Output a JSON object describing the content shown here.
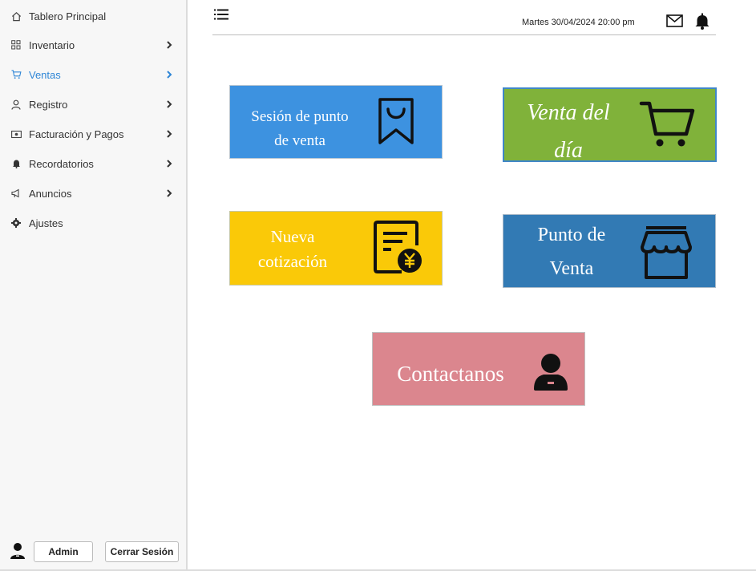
{
  "sidebar": {
    "items": [
      {
        "label": "Tablero Principal",
        "icon": "home-icon",
        "has_chevron": false,
        "active": false
      },
      {
        "label": "Inventario",
        "icon": "grid-icon",
        "has_chevron": true,
        "active": false
      },
      {
        "label": "Ventas",
        "icon": "cart-icon",
        "has_chevron": true,
        "active": true
      },
      {
        "label": "Registro",
        "icon": "user-icon",
        "has_chevron": true,
        "active": false
      },
      {
        "label": "Facturación y Pagos",
        "icon": "cash-icon",
        "has_chevron": true,
        "active": false
      },
      {
        "label": "Recordatorios",
        "icon": "bell-icon",
        "has_chevron": true,
        "active": false
      },
      {
        "label": "Anuncios",
        "icon": "megaphone-icon",
        "has_chevron": true,
        "active": false
      },
      {
        "label": "Ajustes",
        "icon": "gear-icon",
        "has_chevron": false,
        "active": false
      }
    ],
    "user_button": "Admin",
    "logout_button": "Cerrar Sesión"
  },
  "header": {
    "datetime": "Martes 30/04/2024 20:00 pm"
  },
  "tiles": {
    "pos_session": {
      "line1": "Sesión de punto",
      "line2": "de venta",
      "color": "#3d92e0",
      "icon": "bookmark-icon"
    },
    "daily_sales": {
      "line1": "Venta del",
      "line2": "día",
      "color": "#80b23a",
      "icon": "cart-icon"
    },
    "new_quote": {
      "line1": "Nueva",
      "line2": "cotización",
      "color": "#fac908",
      "icon": "invoice-yen-icon"
    },
    "point_of_sale": {
      "line1": "Punto de",
      "line2": "Venta",
      "color": "#327ab4",
      "icon": "store-icon"
    },
    "contact": {
      "label": "Contactanos",
      "color": "#db868e",
      "icon": "user-badge-icon"
    }
  },
  "colors": {
    "accent": "#2f86d6",
    "sidebar_bg": "#f7f7f7"
  }
}
